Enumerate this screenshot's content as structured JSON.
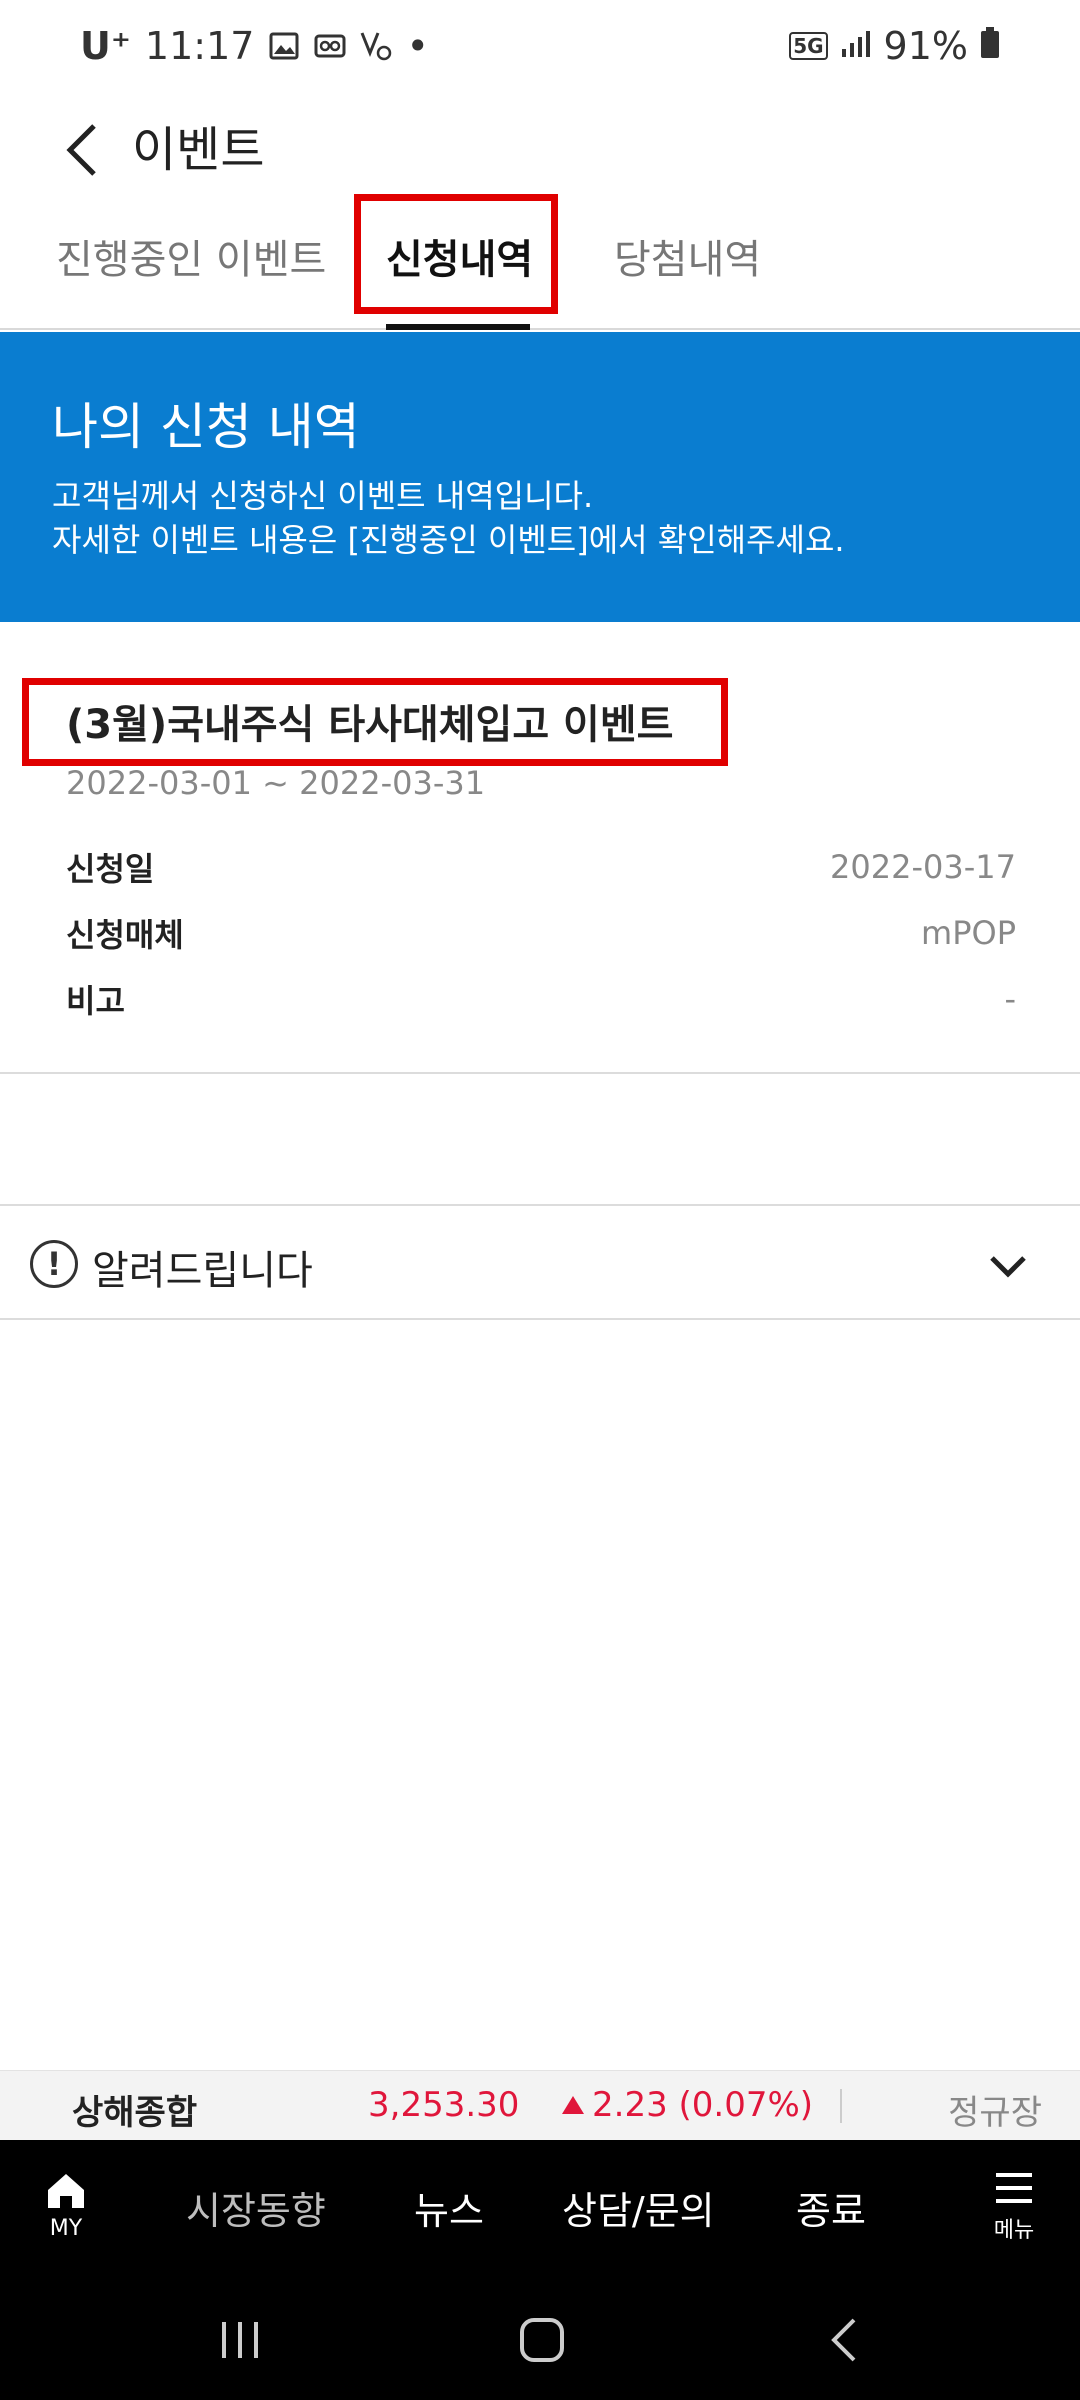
{
  "status_bar": {
    "carrier": "U⁺",
    "time": "11:17",
    "dot": "•",
    "network": "5G",
    "battery": "91%"
  },
  "header": {
    "title": "이벤트"
  },
  "tabs": [
    {
      "label": "진행중인 이벤트",
      "active": false
    },
    {
      "label": "신청내역",
      "active": true
    },
    {
      "label": "당첨내역",
      "active": false
    }
  ],
  "banner": {
    "title": "나의 신청 내역",
    "line1": "고객님께서 신청하신 이벤트 내역입니다.",
    "line2": "자세한 이벤트 내용은 [진행중인 이벤트]에서 확인해주세요."
  },
  "event": {
    "title": "(3월)국내주식 타사대체입고 이벤트",
    "period": "2022-03-01 ~ 2022-03-31",
    "rows": [
      {
        "label": "신청일",
        "value": "2022-03-17"
      },
      {
        "label": "신청매체",
        "value": "mPOP"
      },
      {
        "label": "비고",
        "value": "-"
      }
    ]
  },
  "notice": {
    "icon": "!",
    "label": "알려드립니다"
  },
  "ticker": {
    "name": "상해종합",
    "price": "3,253.30",
    "change": "2.23 (0.07%)",
    "session": "정규장"
  },
  "bottom_nav": {
    "home_label": "MY",
    "items": [
      "시장동향",
      "뉴스",
      "상담/문의",
      "종료"
    ],
    "menu_label": "메뉴"
  },
  "colors": {
    "banner": "#0a7dd0",
    "highlight": "#e00000",
    "ticker_up": "#e0163b"
  }
}
